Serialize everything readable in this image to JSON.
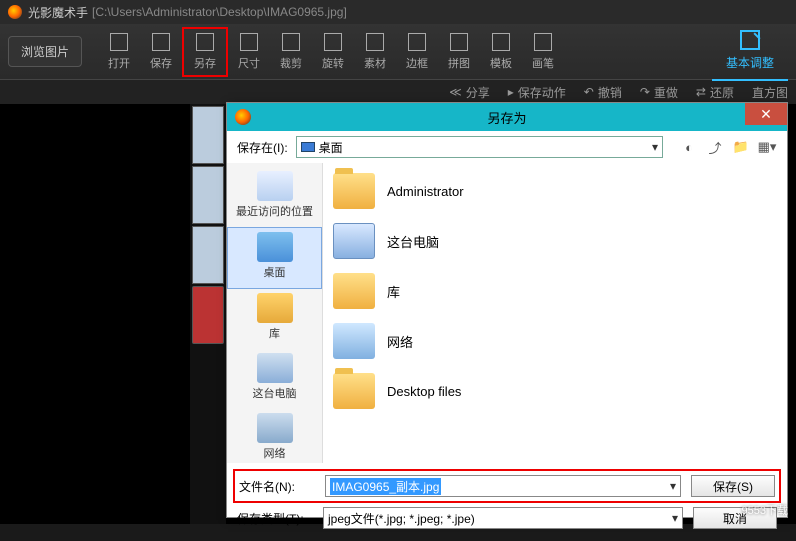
{
  "titlebar": {
    "app_name": "光影魔术手",
    "file_path": "[C:\\Users\\Administrator\\Desktop\\IMAG0965.jpg]"
  },
  "toolbar": {
    "browse": "浏览图片",
    "items": [
      "打开",
      "保存",
      "另存",
      "尺寸",
      "裁剪",
      "旋转",
      "素材",
      "边框",
      "拼图",
      "模板",
      "画笔"
    ],
    "basic_adjust": "基本调整"
  },
  "subbar": {
    "share": "分享",
    "save_action": "保存动作",
    "undo": "撤销",
    "redo": "重做",
    "restore": "还原",
    "histogram": "直方图"
  },
  "dialog": {
    "title": "另存为",
    "close": "✕",
    "save_in_label": "保存在(I):",
    "save_in_value": "桌面",
    "places": [
      "最近访问的位置",
      "桌面",
      "库",
      "这台电脑",
      "网络"
    ],
    "files": [
      "Administrator",
      "这台电脑",
      "库",
      "网络",
      "Desktop files"
    ],
    "filename_label": "文件名(N):",
    "filename_value": "IMAG0965_副本.jpg",
    "filetype_label": "保存类型(T):",
    "filetype_value": "jpeg文件(*.jpg; *.jpeg; *.jpe)",
    "save_btn": "保存(S)",
    "cancel_btn": "取消"
  },
  "watermark": "9553下载"
}
